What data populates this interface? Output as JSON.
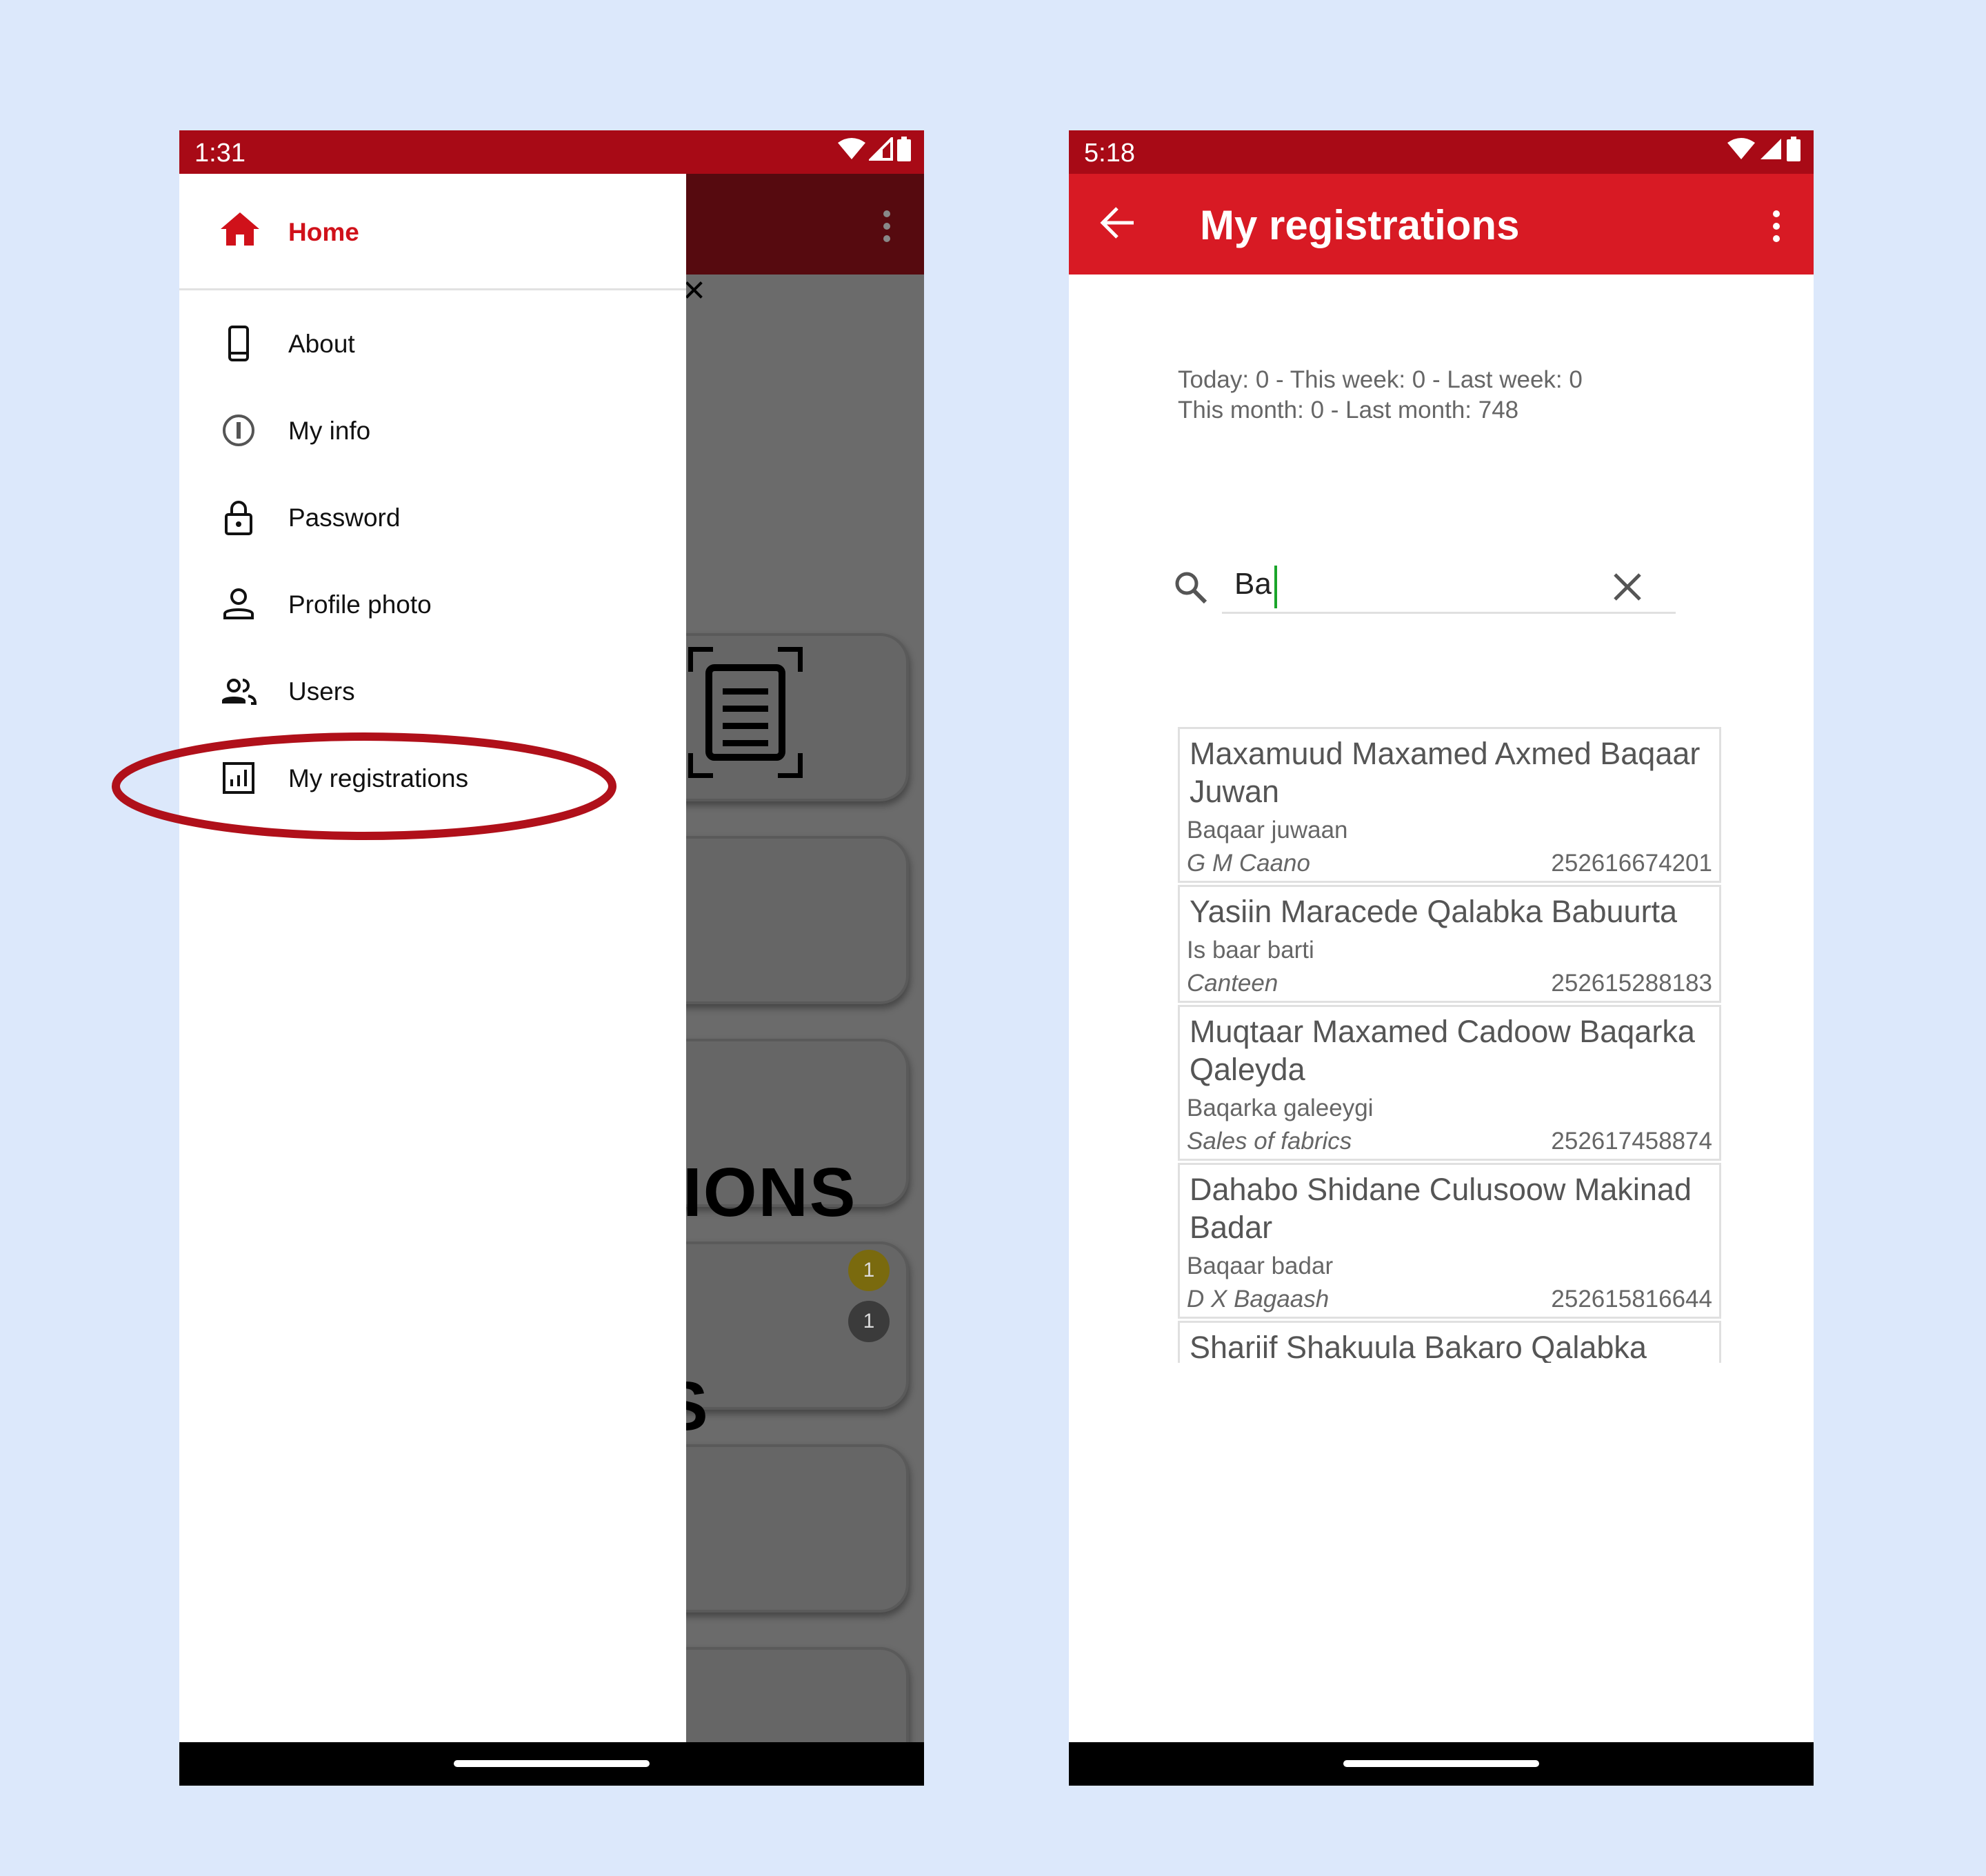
{
  "left_phone": {
    "status_time": "1:31",
    "drawer": {
      "home_label": "Home",
      "items": [
        {
          "label": "About",
          "icon": "phone-device-icon"
        },
        {
          "label": "My info",
          "icon": "info-icon"
        },
        {
          "label": "Password",
          "icon": "lock-icon"
        },
        {
          "label": "Profile photo",
          "icon": "person-icon"
        },
        {
          "label": "Users",
          "icon": "people-icon"
        },
        {
          "label": "My registrations",
          "icon": "chart-icon"
        }
      ]
    },
    "background": {
      "close_glyph": "×",
      "card_text": "IONS",
      "card_text_2": "S",
      "badge_1": "1",
      "badge_2": "1"
    }
  },
  "right_phone": {
    "status_time": "5:18",
    "title": "My registrations",
    "stats_line_1": "Today: 0 - This week: 0 - Last week: 0",
    "stats_line_2": "This month: 0 - Last month: 748",
    "search_value": "Ba",
    "registrations": [
      {
        "name": "Maxamuud Maxamed Axmed Baqaar Juwan",
        "description": "Baqaar juwaan",
        "location": "G M Caano",
        "phone": "252616674201"
      },
      {
        "name": "Yasiin Maracede Qalabka Babuurta",
        "description": "Is baar barti",
        "location": "Canteen",
        "phone": "252615288183"
      },
      {
        "name": "Muqtaar Maxamed Cadoow Baqarka Qaleyda",
        "description": "Baqarka galeeygi",
        "location": "Sales of fabrics",
        "phone": "252617458874"
      },
      {
        "name": "Dahabo Shidane Culusoow Makinad Badar",
        "description": "Baqaar badar",
        "location": "D X Bagaash",
        "phone": "252615816644"
      },
      {
        "name": "Shariif Shakuula Bakaro Qalabka",
        "description": "",
        "location": "",
        "phone": ""
      }
    ]
  },
  "colors": {
    "status_bar": "#a80a16",
    "app_bar": "#d81a24",
    "accent_red": "#d0111a",
    "highlight_oval": "#b0101a",
    "page_background": "#dce8fb"
  }
}
